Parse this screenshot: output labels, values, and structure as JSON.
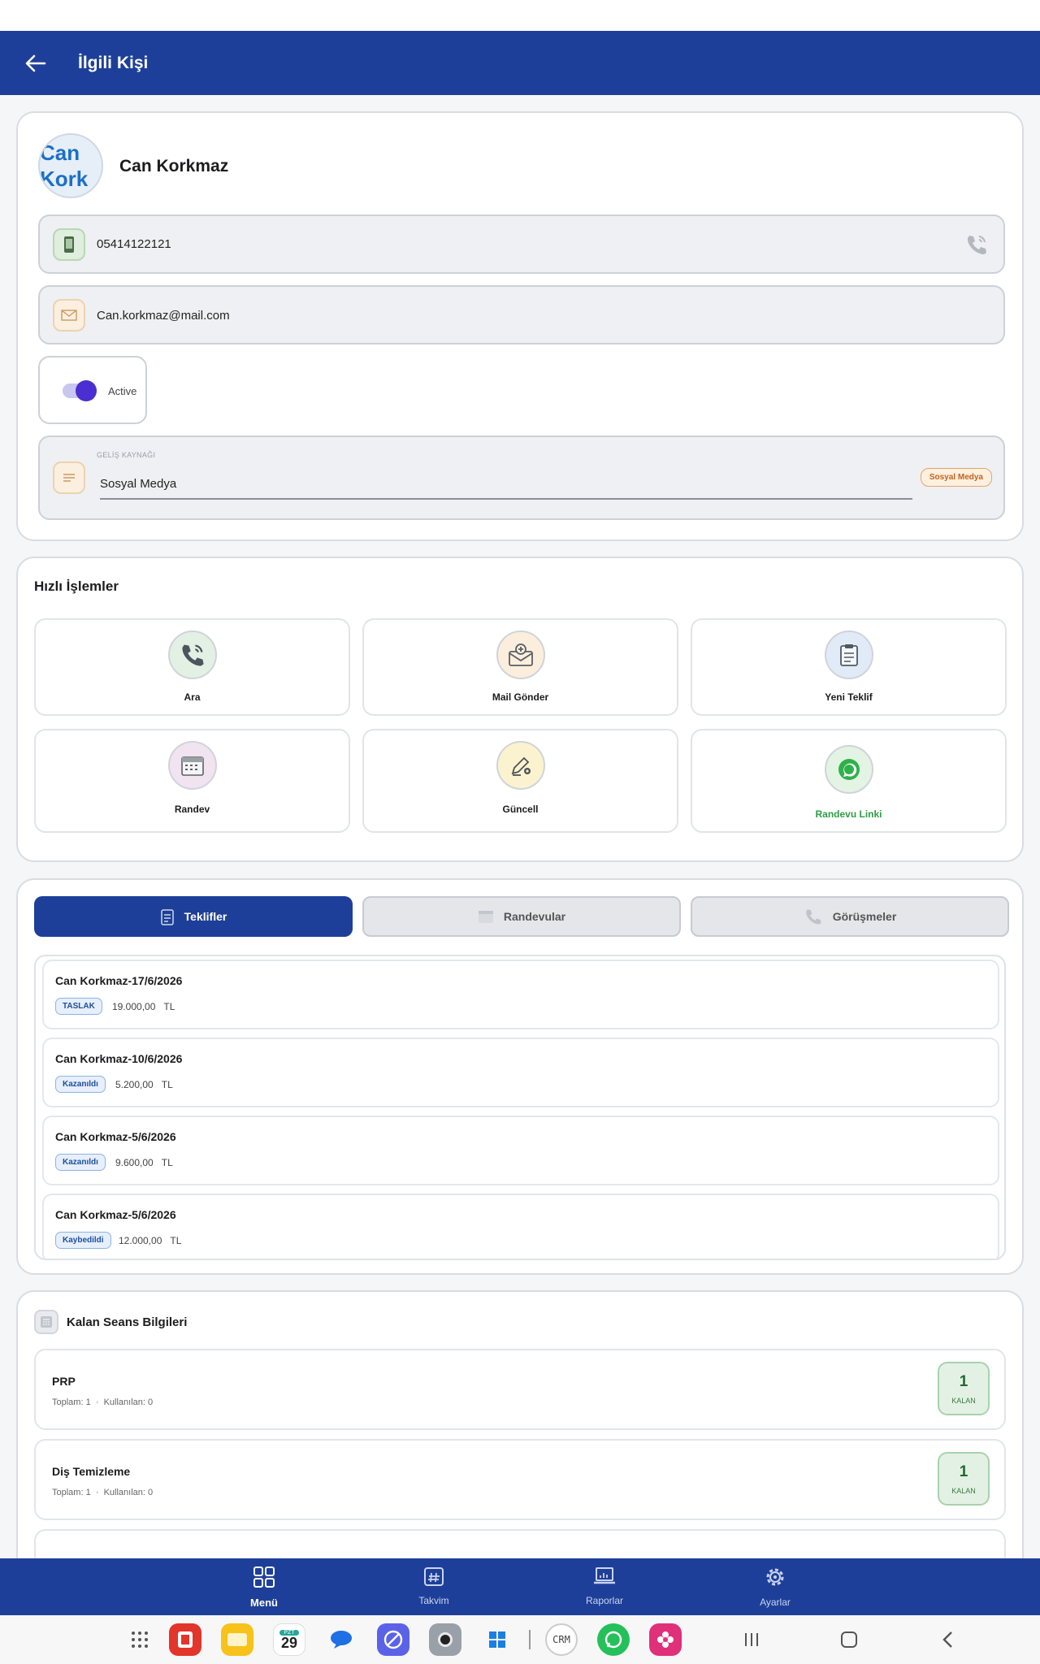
{
  "appbar": {
    "title": "İlgili Kişi"
  },
  "contact": {
    "avatar_text": "Can\nKork",
    "name": "Can Korkmaz",
    "phone": "05414122121",
    "email": "Can.korkmaz@mail.com",
    "status_label": "Active",
    "status_on": true,
    "source_label": "GELİŞ KAYNAĞI",
    "source_value": "Sosyal Medya",
    "source_chip": "Sosyal Medya"
  },
  "quick_actions": {
    "title": "Hızlı İşlemler",
    "items": [
      {
        "label": "Ara",
        "icon": "phone-call-icon"
      },
      {
        "label": "Mail Gönder",
        "icon": "mail-send-icon"
      },
      {
        "label": "Yeni Teklif",
        "icon": "clipboard-icon"
      },
      {
        "label": "Randev",
        "icon": "calendar-icon"
      },
      {
        "label": "Güncell",
        "icon": "edit-icon"
      },
      {
        "label": "Randevu Linki",
        "icon": "whatsapp-icon"
      }
    ]
  },
  "tabs": [
    {
      "label": "Teklifler",
      "active": true
    },
    {
      "label": "Randevular",
      "active": false
    },
    {
      "label": "Görüşmeler",
      "active": false
    }
  ],
  "offers": [
    {
      "title": "Can Korkmaz-17/6/2026",
      "status": "TASLAK",
      "amount": "19.000,00",
      "currency": "TL"
    },
    {
      "title": "Can Korkmaz-10/6/2026",
      "status": "Kazanıldı",
      "amount": "5.200,00",
      "currency": "TL"
    },
    {
      "title": "Can Korkmaz-5/6/2026",
      "status": "Kazanıldı",
      "amount": "9.600,00",
      "currency": "TL"
    },
    {
      "title": "Can Korkmaz-5/6/2026",
      "status": "Kaybedildi",
      "amount": "12.000,00",
      "currency": "TL"
    }
  ],
  "sessions": {
    "title": "Kalan Seans Bilgileri",
    "items": [
      {
        "name": "PRP",
        "total": "Toplam: 1",
        "used": "Kullanılan: 0",
        "remaining": "1",
        "remaining_label": "KALAN"
      },
      {
        "name": "Diş Temizleme",
        "total": "Toplam: 1",
        "used": "Kullanılan: 0",
        "remaining": "1",
        "remaining_label": "KALAN"
      }
    ]
  },
  "bottom_nav": [
    {
      "label": "Menü",
      "icon": "grid-icon",
      "active": true
    },
    {
      "label": "Takvim",
      "icon": "calendar-hash-icon",
      "active": false
    },
    {
      "label": "Raporlar",
      "icon": "laptop-chart-icon",
      "active": false
    },
    {
      "label": "Ayarlar",
      "icon": "gear-icon",
      "active": false
    }
  ],
  "taskbar": {
    "calendar_day": "PZT",
    "calendar_date": "29",
    "crm_label": "CRM"
  },
  "colors": {
    "primary": "#1e3f99",
    "success": "#2f9e44",
    "warning": "#c6611b"
  }
}
